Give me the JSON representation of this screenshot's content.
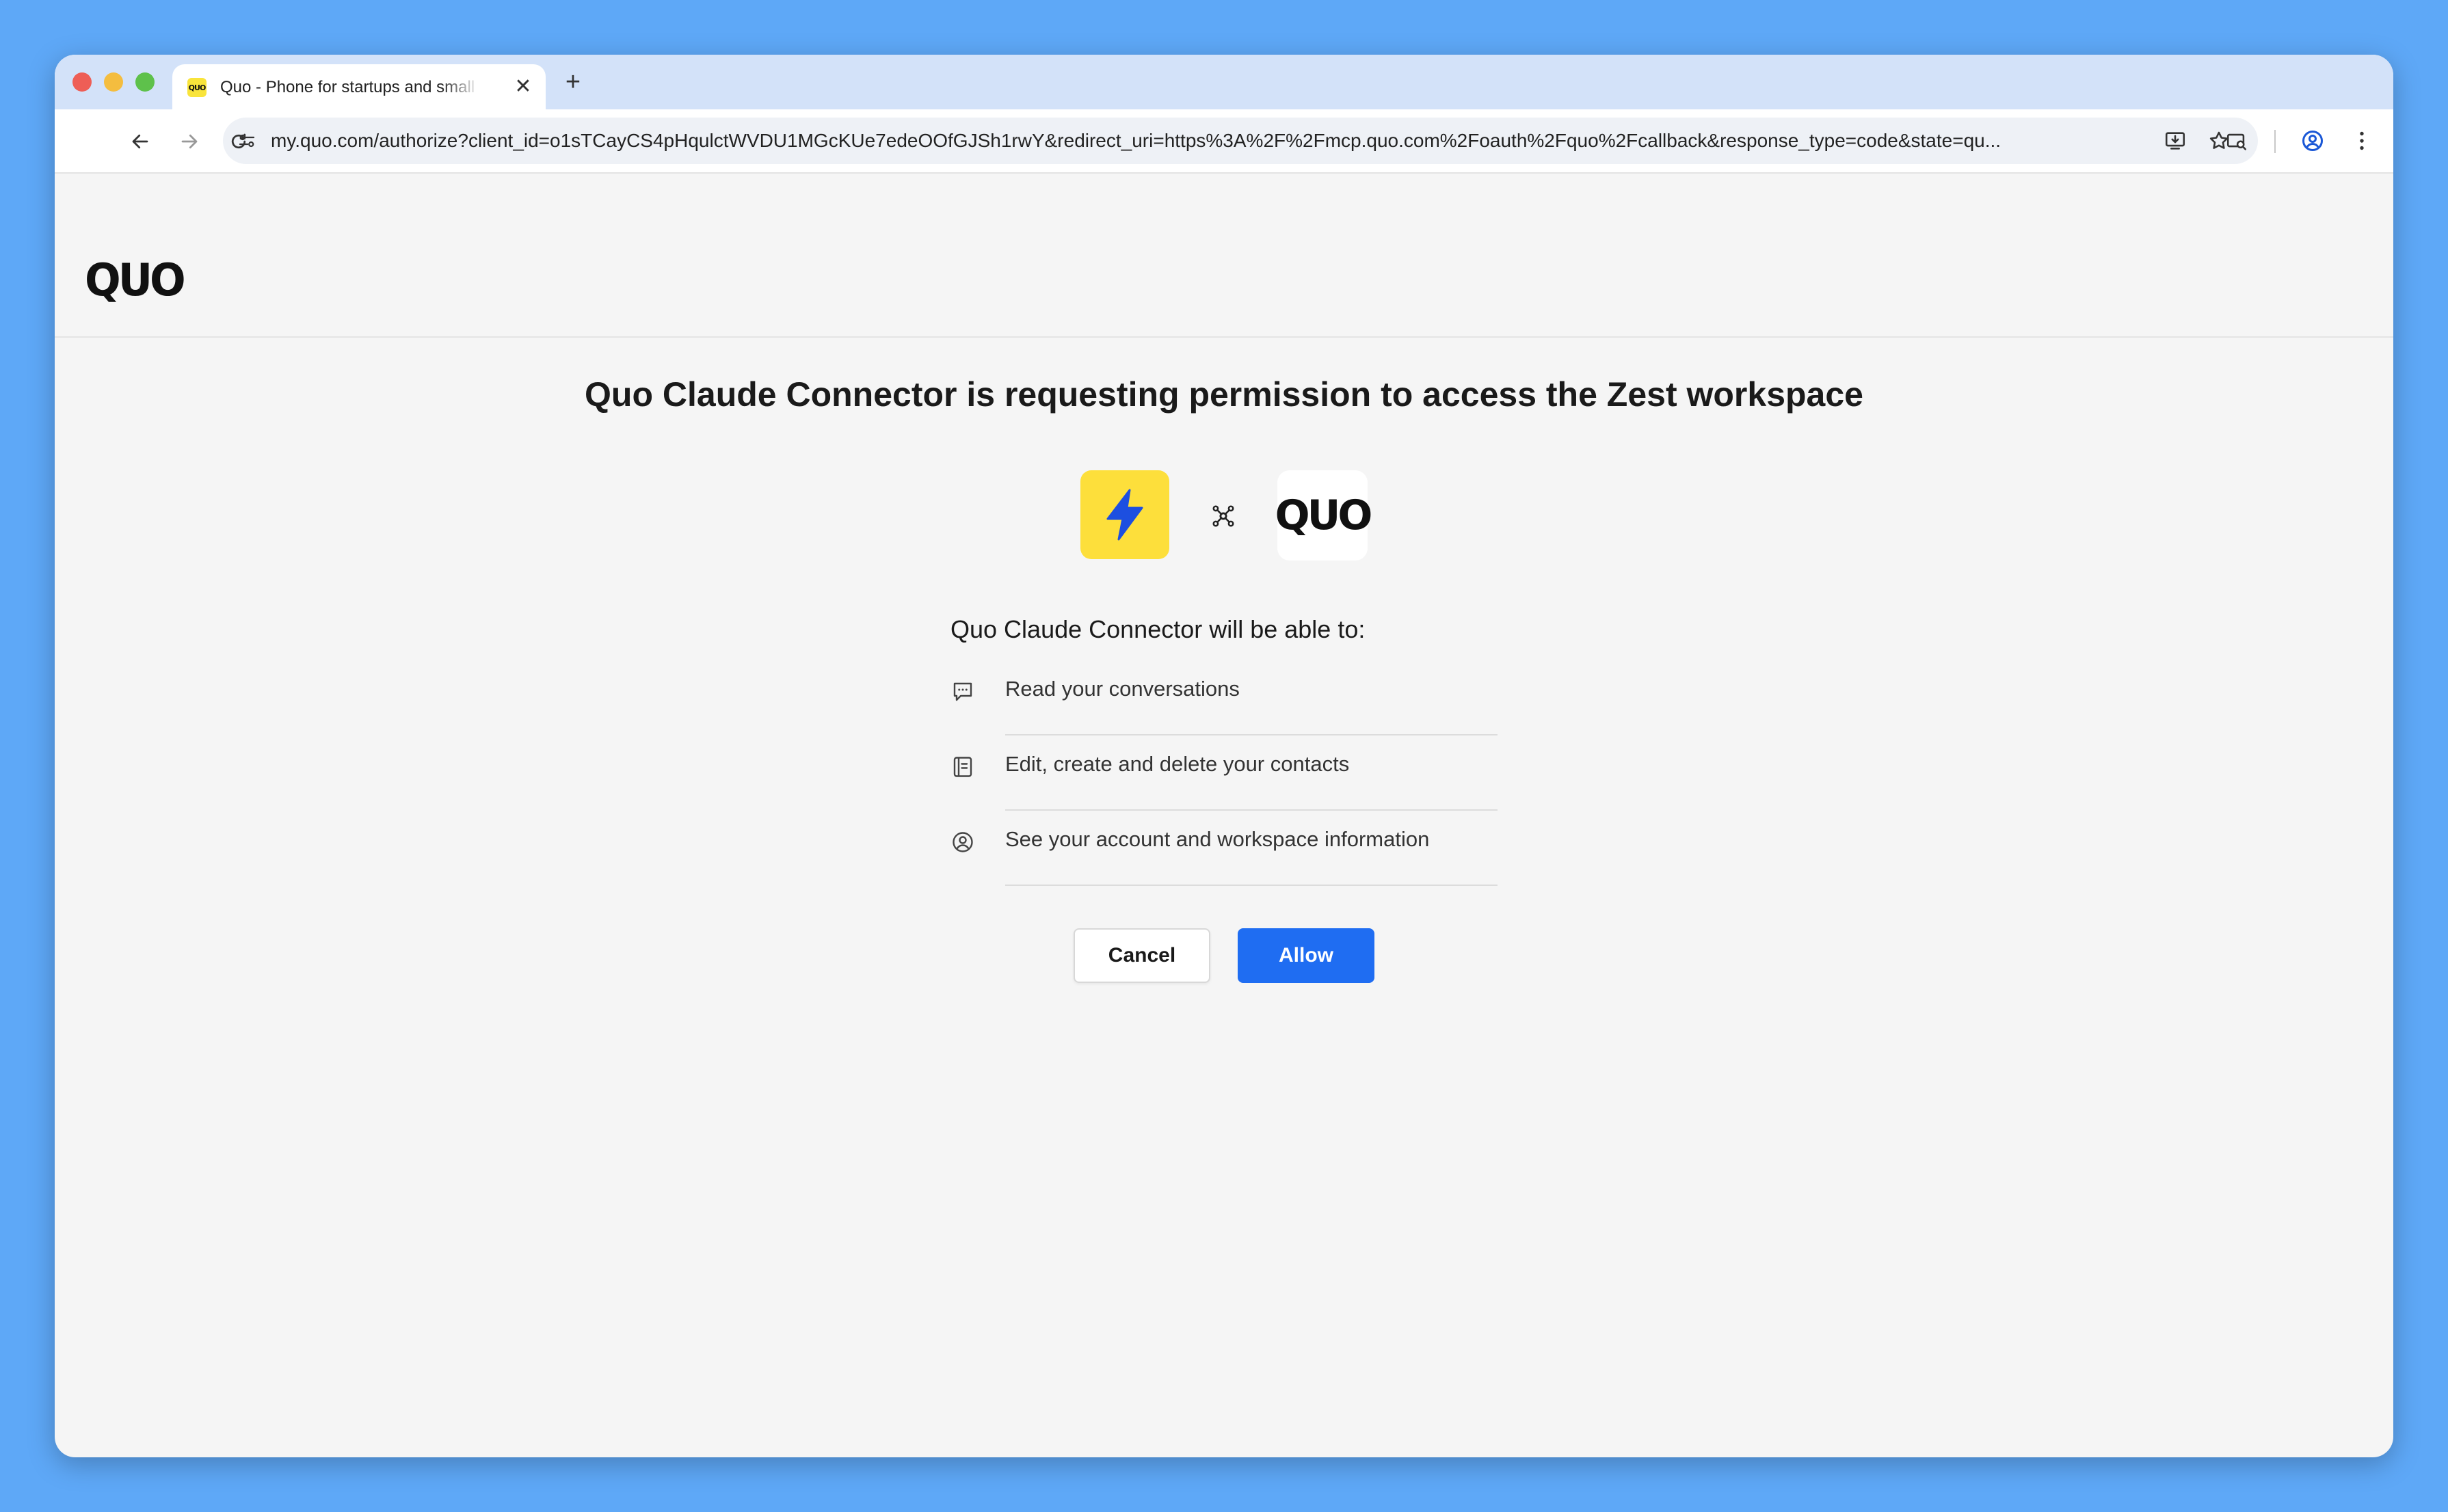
{
  "browser": {
    "tab": {
      "favicon_text": "QUO",
      "title": "Quo - Phone for startups and small businesses",
      "close_glyph": "✕"
    },
    "new_tab_glyph": "+",
    "url": "my.quo.com/authorize?client_id=o1sTCayCS4pHqulctWVDU1MGcKUe7edeOOfGJSh1rwY&redirect_uri=https%3A%2F%2Fmcp.quo.com%2Foauth%2Fquo%2Fcallback&response_type=code&state=qu..."
  },
  "page": {
    "logo": "QUO",
    "heading": "Quo Claude Connector is requesting permission to access the Zest workspace",
    "quo_tile_text": "QUO",
    "permissions_title": "Quo Claude Connector will be able to:",
    "permissions": [
      {
        "icon": "chat-bubble-icon",
        "label": "Read your conversations"
      },
      {
        "icon": "contacts-book-icon",
        "label": "Edit, create and delete your contacts"
      },
      {
        "icon": "user-circle-icon",
        "label": "See your account and workspace information"
      }
    ],
    "cancel_label": "Cancel",
    "allow_label": "Allow"
  },
  "colors": {
    "desktop": "#5ea8f7",
    "app_icon_bg": "#fddf3b",
    "bolt": "#1d4fe0",
    "allow_button": "#1f6df2"
  }
}
